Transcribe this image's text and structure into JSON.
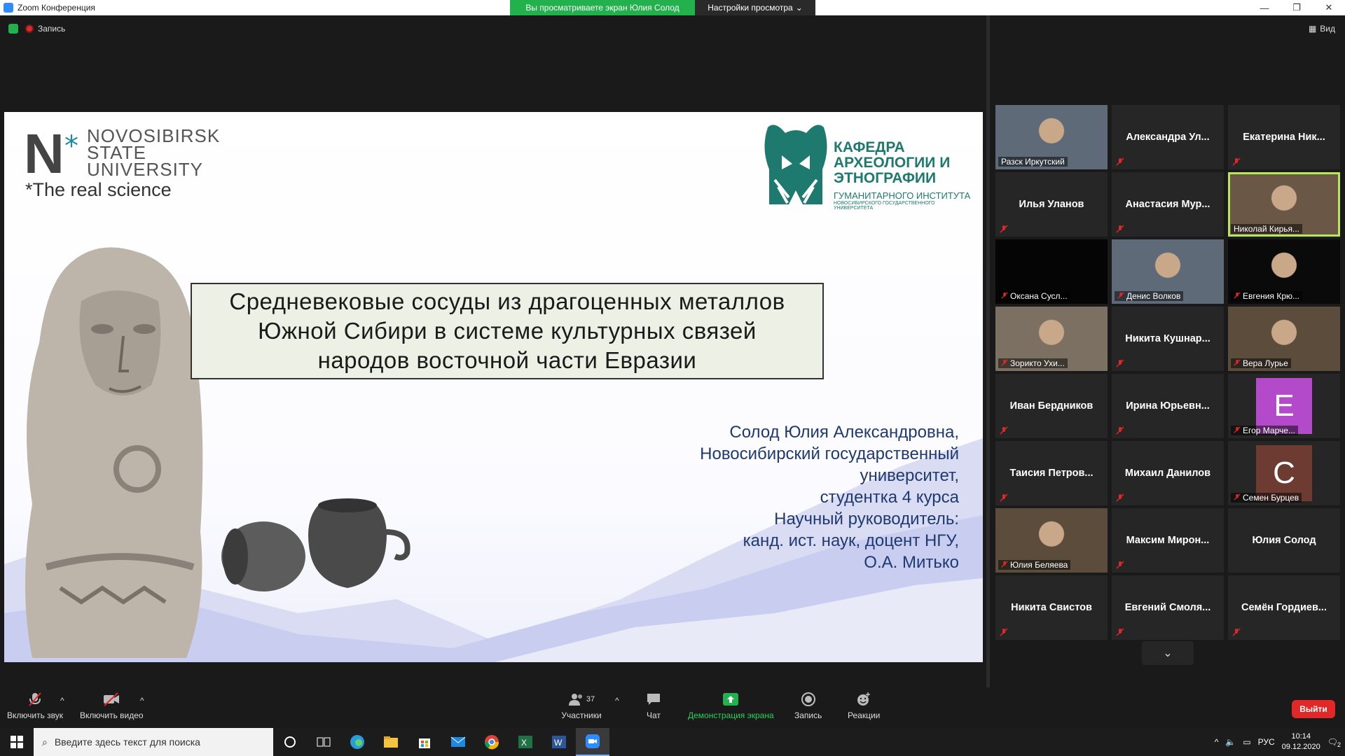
{
  "window": {
    "title": "Zoom Конференция",
    "share_banner": "Вы просматриваете экран Юлия Солод",
    "view_options": "Настройки просмотра",
    "minimize": "—",
    "restore": "❐",
    "close": "✕"
  },
  "meeting": {
    "recording_label": "Запись",
    "view_label": "Вид"
  },
  "slide": {
    "nsu_logo_letter": "N",
    "nsu_lines": [
      "NOVOSIBIRSK",
      "STATE",
      "UNIVERSITY"
    ],
    "nsu_slogan": "The real science",
    "dept_name": "КАФЕДРА АРХЕОЛОГИИ И ЭТНОГРАФИИ",
    "dept_sub": "ГУМАНИТАРНОГО ИНСТИТУТА",
    "dept_sub2": "НОВОСИБИРСКОГО ГОСУДАРСТВЕННОГО УНИВЕРСИТЕТА",
    "title_lines": [
      "Средневековые сосуды из драгоценных металлов",
      "Южной Сибири в системе культурных связей",
      "народов восточной части Евразии"
    ],
    "author_lines": [
      "Солод Юлия Александровна,",
      "Новосибирский государственный",
      "университет,",
      "студентка 4 курса",
      "Научный руководитель:",
      "канд. ист. наук, доцент НГУ,",
      "О.А. Митько"
    ]
  },
  "participants": [
    {
      "name": "Разск Иркутский",
      "type": "video"
    },
    {
      "name": "Александра  Ул...",
      "type": "name",
      "muted": true
    },
    {
      "name": "Екатерина  Ник...",
      "type": "name",
      "muted": true
    },
    {
      "name": "Илья Уланов",
      "type": "name",
      "muted": true
    },
    {
      "name": "Анастасия  Мур...",
      "type": "name",
      "muted": true
    },
    {
      "name": "Николай Кирья...",
      "type": "video",
      "active": true
    },
    {
      "name": "Оксана Сусл...",
      "type": "video-dark",
      "muted": true
    },
    {
      "name": "Денис Волков",
      "type": "video",
      "muted": true
    },
    {
      "name": "Евгения Крю...",
      "type": "video",
      "muted": true
    },
    {
      "name": "Зорикто Ухи...",
      "type": "video",
      "muted": true
    },
    {
      "name": "Никита  Кушнар...",
      "type": "name",
      "muted": true
    },
    {
      "name": "Вера Лурье",
      "type": "video",
      "muted": true
    },
    {
      "name": "Иван Бердников",
      "type": "name",
      "muted": true
    },
    {
      "name": "Ирина  Юрьевн...",
      "type": "name",
      "muted": true
    },
    {
      "name": "Егор Марче...",
      "type": "avatar",
      "letter": "E",
      "color": "#b34ac9",
      "muted": true
    },
    {
      "name": "Таисия  Петров...",
      "type": "name",
      "muted": true
    },
    {
      "name": "Михаил Данилов",
      "type": "name",
      "muted": true
    },
    {
      "name": "Семен Бурцев",
      "type": "avatar",
      "letter": "C",
      "color": "#6e3b32",
      "muted": true
    },
    {
      "name": "Юлия Беляева",
      "type": "video",
      "muted": true
    },
    {
      "name": "Максим  Мирон...",
      "type": "name",
      "muted": true
    },
    {
      "name": "Юлия Солод",
      "type": "name",
      "muted": false
    },
    {
      "name": "Никита Свистов",
      "type": "name",
      "muted": true
    },
    {
      "name": "Евгений  Смоля...",
      "type": "name",
      "muted": true
    },
    {
      "name": "Семён  Гордиев...",
      "type": "name",
      "muted": true
    }
  ],
  "toolbar": {
    "audio": "Включить звук",
    "video": "Включить видео",
    "participants": "Участники",
    "participants_count": "37",
    "chat": "Чат",
    "share": "Демонстрация экрана",
    "record": "Запись",
    "reactions": "Реакции",
    "leave": "Выйти"
  },
  "taskbar": {
    "search_placeholder": "Введите здесь текст для поиска",
    "lang": "РУС",
    "time": "10:14",
    "date": "09.12.2020",
    "notif_count": "2"
  },
  "colors": {
    "zoom_green": "#23b14d",
    "leave_red": "#e02828",
    "active_speaker": "#b9e55b",
    "dept_teal": "#1e7a6e",
    "author_blue": "#1f3a70"
  }
}
